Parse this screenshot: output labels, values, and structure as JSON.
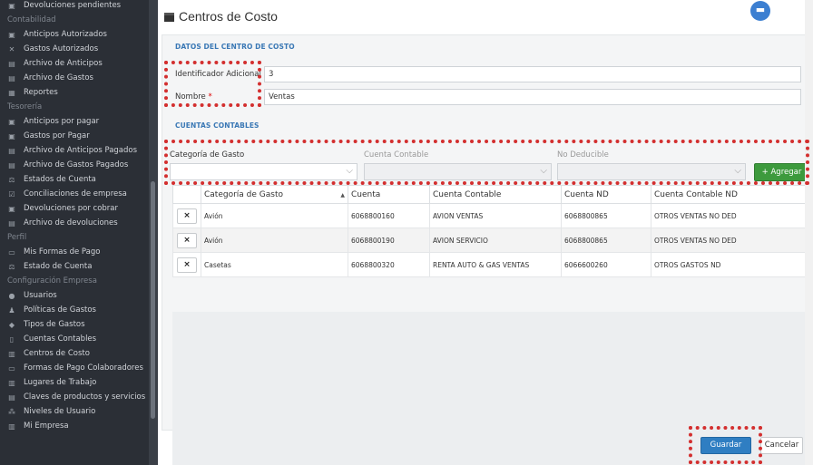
{
  "sidebar": {
    "items": [
      {
        "type": "item",
        "label": "Devoluciones pendientes",
        "icon": "money-icon"
      },
      {
        "type": "section",
        "label": "Contabilidad"
      },
      {
        "type": "item",
        "label": "Anticipos Autorizados",
        "icon": "money-icon"
      },
      {
        "type": "item",
        "label": "Gastos Autorizados",
        "icon": "cross-tools-icon"
      },
      {
        "type": "item",
        "label": "Archivo de Anticipos",
        "icon": "archive-icon"
      },
      {
        "type": "item",
        "label": "Archivo de Gastos",
        "icon": "archive-icon"
      },
      {
        "type": "item",
        "label": "Reportes",
        "icon": "table-icon"
      },
      {
        "type": "section",
        "label": "Tesorería"
      },
      {
        "type": "item",
        "label": "Anticipos por pagar",
        "icon": "money-icon"
      },
      {
        "type": "item",
        "label": "Gastos por Pagar",
        "icon": "money-icon"
      },
      {
        "type": "item",
        "label": "Archivo de Anticipos Pagados",
        "icon": "archive-icon"
      },
      {
        "type": "item",
        "label": "Archivo de Gastos Pagados",
        "icon": "archive-icon"
      },
      {
        "type": "item",
        "label": "Estados de Cuenta",
        "icon": "scale-icon"
      },
      {
        "type": "item",
        "label": "Conciliaciones de empresa",
        "icon": "check-icon"
      },
      {
        "type": "item",
        "label": "Devoluciones por cobrar",
        "icon": "money-icon"
      },
      {
        "type": "item",
        "label": "Archivo de devoluciones",
        "icon": "archive-icon"
      },
      {
        "type": "section",
        "label": "Perfil"
      },
      {
        "type": "item",
        "label": "Mis Formas de Pago",
        "icon": "card-icon"
      },
      {
        "type": "item",
        "label": "Estado de Cuenta",
        "icon": "scale-icon"
      },
      {
        "type": "section",
        "label": "Configuración Empresa"
      },
      {
        "type": "item",
        "label": "Usuarios",
        "icon": "users-icon"
      },
      {
        "type": "item",
        "label": "Políticas de Gastos",
        "icon": "gavel-icon"
      },
      {
        "type": "item",
        "label": "Tipos de Gastos",
        "icon": "tag-icon"
      },
      {
        "type": "item",
        "label": "Cuentas Contables",
        "icon": "book-icon"
      },
      {
        "type": "item",
        "label": "Centros de Costo",
        "icon": "building-icon"
      },
      {
        "type": "item",
        "label": "Formas de Pago Colaboradores",
        "icon": "card-icon"
      },
      {
        "type": "item",
        "label": "Lugares de Trabajo",
        "icon": "building-icon"
      },
      {
        "type": "item",
        "label": "Claves de productos y servicios",
        "icon": "archive-icon"
      },
      {
        "type": "item",
        "label": "Niveles de Usuario",
        "icon": "sitemap-icon"
      },
      {
        "type": "item",
        "label": "Mi Empresa",
        "icon": "building-icon"
      }
    ]
  },
  "page": {
    "title": "Centros de Costo"
  },
  "form": {
    "section_title": "DATOS DEL CENTRO DE COSTO",
    "identificador_label": "Identificador Adicional",
    "identificador_value": "3",
    "nombre_label": "Nombre",
    "nombre_required": "*",
    "nombre_value": "Ventas"
  },
  "cuentas": {
    "section_title": "CUENTAS CONTABLES",
    "categoria_label": "Categoría de Gasto",
    "cuenta_label": "Cuenta Contable",
    "nodeducible_label": "No Deducible",
    "add_button": "+ Agregar"
  },
  "table": {
    "headers": [
      "",
      "Categoría de Gasto",
      "Cuenta",
      "Cuenta Contable",
      "Cuenta ND",
      "Cuenta Contable ND"
    ],
    "delete_label": "×",
    "rows": [
      {
        "categoria": "Avión",
        "cuenta": "6068800160",
        "cuenta_contable": "AVION VENTAS",
        "cuenta_nd": "6068800865",
        "cuenta_contable_nd": "OTROS VENTAS NO DED"
      },
      {
        "categoria": "Avión",
        "cuenta": "6068800190",
        "cuenta_contable": "AVION SERVICIO",
        "cuenta_nd": "6068800865",
        "cuenta_contable_nd": "OTROS VENTAS NO DED"
      },
      {
        "categoria": "Casetas",
        "cuenta": "6068800320",
        "cuenta_contable": "RENTA AUTO & GAS VENTAS",
        "cuenta_nd": "6066600260",
        "cuenta_contable_nd": "OTROS GASTOS ND"
      }
    ]
  },
  "footer": {
    "save": "Guardar",
    "cancel": "Cancelar"
  },
  "colors": {
    "sidebar_bg": "#2b2f36",
    "accent": "#2f7ec2",
    "add_green": "#3d9a3d",
    "highlight": "#d32f2f"
  }
}
